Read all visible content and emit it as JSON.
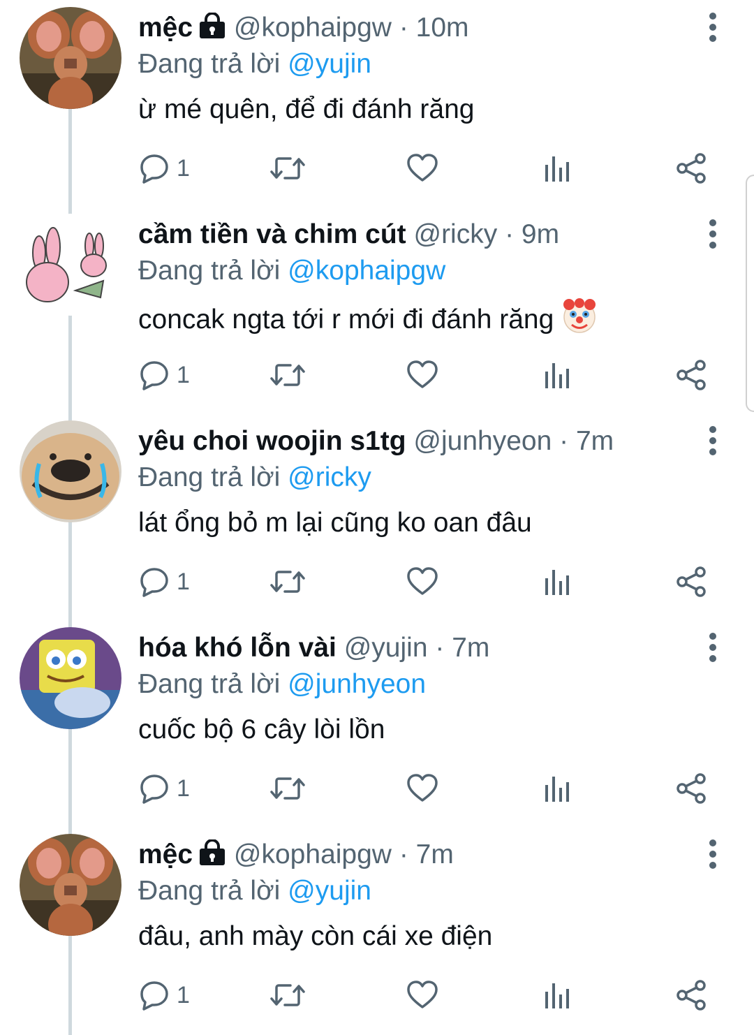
{
  "tweets": [
    {
      "name": "mệc",
      "locked": true,
      "handle": "@kophaipgw",
      "dot": "·",
      "time": "10m",
      "reply_prefix": "Đang trả lời",
      "reply_to": "@yujin",
      "text": "ừ mé quên, để đi đánh răng",
      "reply_count": "1",
      "avatar": "jerry-mouse"
    },
    {
      "name": "cầm tiền và chim cút",
      "locked": false,
      "handle": "@ricky",
      "dot": "·",
      "time": "9m",
      "reply_prefix": "Đang trả lời",
      "reply_to": "@kophaipgw",
      "text": "concak ngta tới r mới đi đánh răng",
      "emoji": "clown-face",
      "reply_count": "1",
      "avatar": "pink-rabbits"
    },
    {
      "name": "yêu choi woojin s1tg",
      "locked": false,
      "handle": "@junhyeon",
      "dot": "·",
      "time": "7m",
      "reply_prefix": "Đang trả lời",
      "reply_to": "@ricky",
      "text": "lát ổng bỏ m lại cũng ko oan đâu",
      "reply_count": "1",
      "avatar": "crying-dog"
    },
    {
      "name": "hóa khó lỗn vài",
      "locked": false,
      "handle": "@yujin",
      "dot": "·",
      "time": "7m",
      "reply_prefix": "Đang trả lời",
      "reply_to": "@junhyeon",
      "text": "cuốc bộ 6 cây lòi lồn",
      "reply_count": "1",
      "avatar": "crying-spongebob"
    },
    {
      "name": "mệc",
      "locked": true,
      "handle": "@kophaipgw",
      "dot": "·",
      "time": "7m",
      "reply_prefix": "Đang trả lời",
      "reply_to": "@yujin",
      "text": "đâu, anh mày còn cái xe điện",
      "reply_count": "1",
      "avatar": "jerry-mouse"
    }
  ],
  "colors": {
    "text": "#0f1419",
    "secondary": "#536471",
    "link": "#1d9bf0",
    "thread_line": "#cfd9de"
  }
}
